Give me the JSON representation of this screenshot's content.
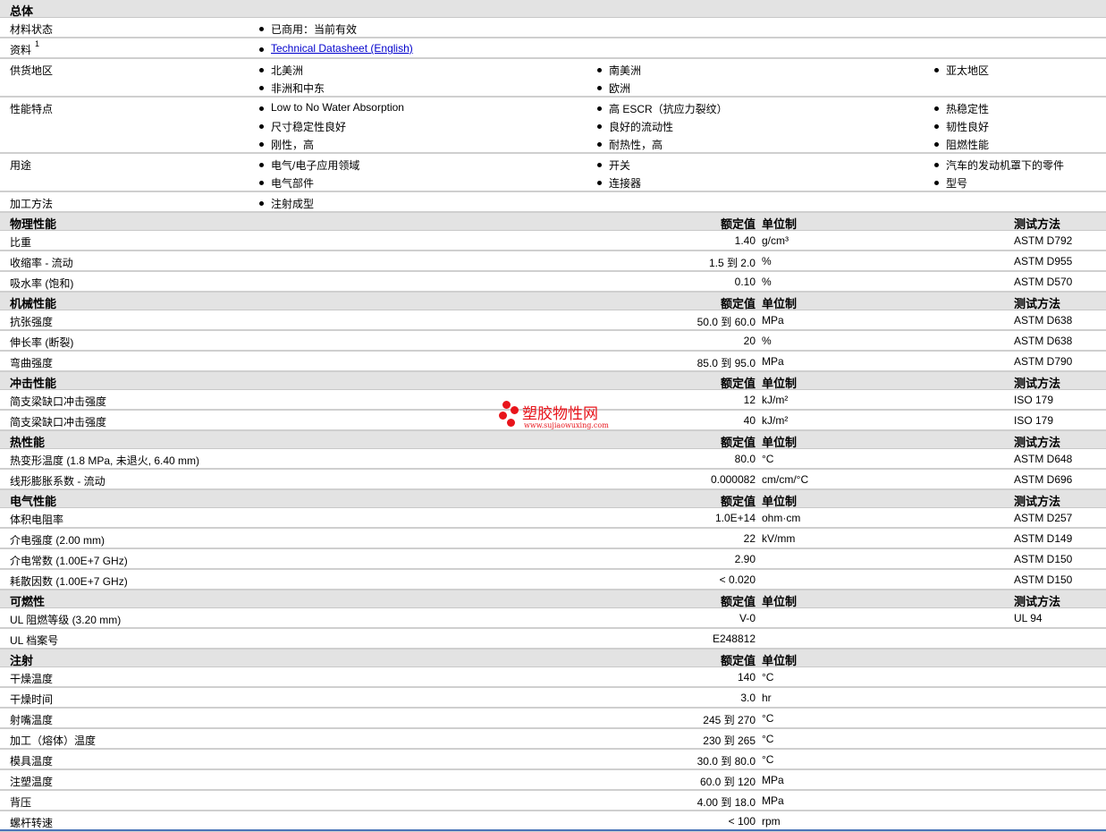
{
  "general": {
    "title": "总体",
    "rows": [
      {
        "label": "材料状态",
        "items": [
          [
            "已商用：当前有效"
          ]
        ]
      },
      {
        "label": "资料",
        "sup": "1",
        "link": "Technical Datasheet (English)"
      },
      {
        "label": "供货地区",
        "items": [
          [
            "北美洲",
            "非洲和中东"
          ],
          [
            "南美洲",
            "欧洲"
          ],
          [
            "亚太地区"
          ]
        ]
      },
      {
        "label": "性能特点",
        "items": [
          [
            "Low to No Water Absorption",
            "尺寸稳定性良好",
            "刚性，高"
          ],
          [
            "高 ESCR（抗应力裂纹）",
            "良好的流动性",
            "耐热性，高"
          ],
          [
            "热稳定性",
            "韧性良好",
            "阻燃性能"
          ]
        ]
      },
      {
        "label": "用途",
        "items": [
          [
            "电气/电子应用领域",
            "电气部件"
          ],
          [
            "开关",
            "连接器"
          ],
          [
            "汽车的发动机罩下的零件",
            "型号"
          ]
        ]
      },
      {
        "label": "加工方法",
        "items": [
          [
            "注射成型"
          ]
        ]
      }
    ]
  },
  "headers": {
    "value": "额定值",
    "unit": "单位制",
    "test": "测试方法"
  },
  "sections": [
    {
      "title": "物理性能",
      "test_header": true,
      "rows": [
        {
          "label": "比重",
          "value": "1.40",
          "unit": "g/cm³",
          "test": "ASTM D792"
        },
        {
          "label": "收缩率 - 流动",
          "value": "1.5 到  2.0",
          "unit": "%",
          "test": "ASTM D955"
        },
        {
          "label": "吸水率 (饱和)",
          "value": "0.10",
          "unit": "%",
          "test": "ASTM D570"
        }
      ]
    },
    {
      "title": "机械性能",
      "test_header": true,
      "rows": [
        {
          "label": "抗张强度",
          "value": "50.0 到  60.0",
          "unit": "MPa",
          "test": "ASTM D638"
        },
        {
          "label": "伸长率 (断裂)",
          "value": "20",
          "unit": "%",
          "test": "ASTM D638"
        },
        {
          "label": "弯曲强度",
          "value": "85.0 到  95.0",
          "unit": "MPa",
          "test": "ASTM D790"
        }
      ]
    },
    {
      "title": "冲击性能",
      "test_header": true,
      "rows": [
        {
          "label": "简支梁缺口冲击强度",
          "value": "12",
          "unit": "kJ/m²",
          "test": "ISO 179"
        },
        {
          "label": "简支梁缺口冲击强度",
          "value": "40",
          "unit": "kJ/m²",
          "test": "ISO 179"
        }
      ]
    },
    {
      "title": "热性能",
      "test_header": true,
      "rows": [
        {
          "label": "热变形温度 (1.8 MPa, 未退火, 6.40 mm)",
          "value": "80.0",
          "unit": "°C",
          "test": "ASTM D648"
        },
        {
          "label": "线形膨胀系数 - 流动",
          "value": "0.000082",
          "unit": "cm/cm/°C",
          "test": "ASTM D696"
        }
      ]
    },
    {
      "title": "电气性能",
      "test_header": true,
      "rows": [
        {
          "label": "体积电阻率",
          "value": "1.0E+14",
          "unit": "ohm·cm",
          "test": "ASTM D257"
        },
        {
          "label": "介电强度 (2.00 mm)",
          "value": "22",
          "unit": "kV/mm",
          "test": "ASTM D149"
        },
        {
          "label": "介电常数 (1.00E+7 GHz)",
          "value": "2.90",
          "unit": "",
          "test": "ASTM D150"
        },
        {
          "label": "耗散因数 (1.00E+7 GHz)",
          "value": "< 0.020",
          "unit": "",
          "test": "ASTM D150"
        }
      ]
    },
    {
      "title": "可燃性",
      "test_header": true,
      "rows": [
        {
          "label": "UL 阻燃等级 (3.20 mm)",
          "value": "V-0",
          "unit": "",
          "test": "UL 94"
        },
        {
          "label": "UL 档案号",
          "value": "E248812",
          "unit": "",
          "test": ""
        }
      ]
    },
    {
      "title": "注射",
      "test_header": false,
      "rows": [
        {
          "label": "干燥温度",
          "value": "140",
          "unit": "°C",
          "test": ""
        },
        {
          "label": "干燥时间",
          "value": "3.0",
          "unit": "hr",
          "test": ""
        },
        {
          "label": "射嘴温度",
          "value": "245 到  270",
          "unit": "°C",
          "test": ""
        },
        {
          "label": "加工（熔体）温度",
          "value": "230 到  265",
          "unit": "°C",
          "test": ""
        },
        {
          "label": "模具温度",
          "value": "30.0 到  80.0",
          "unit": "°C",
          "test": ""
        },
        {
          "label": "注塑温度",
          "value": "60.0 到  120",
          "unit": "MPa",
          "test": ""
        },
        {
          "label": "背压",
          "value": "4.00 到  18.0",
          "unit": "MPa",
          "test": ""
        },
        {
          "label": "螺杆转速",
          "value": "< 100",
          "unit": "rpm",
          "test": ""
        }
      ]
    }
  ],
  "watermark": {
    "title": "塑胶物性网",
    "url": "www.sujiaowuxing.com"
  }
}
